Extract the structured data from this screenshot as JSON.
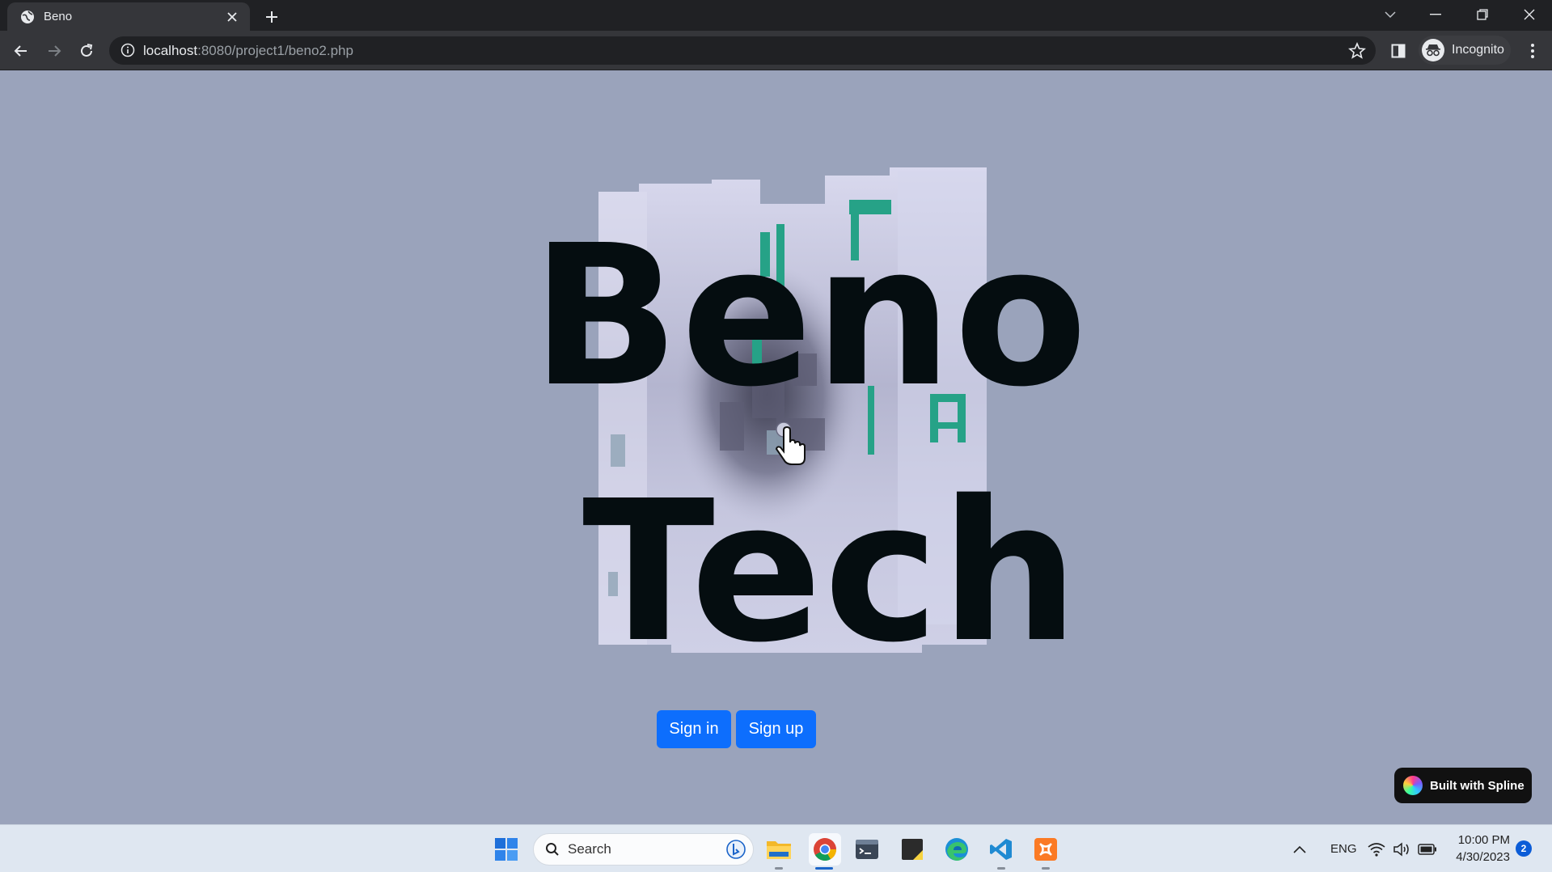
{
  "browser": {
    "tab_title": "Beno",
    "url_host": "localhost",
    "url_rest": ":8080/project1/beno2.php",
    "profile_label": "Incognito"
  },
  "page": {
    "hero_line1": "Beno",
    "hero_line2": "Tech",
    "signin_label": "Sign in",
    "signup_label": "Sign up",
    "spline_badge": "Built with Spline",
    "background_color": "#9aa3bb",
    "button_color": "#0d6efd",
    "accent_color": "#1fa58a"
  },
  "taskbar": {
    "search_placeholder": "Search",
    "language": "ENG",
    "time": "10:00 PM",
    "date": "4/30/2023",
    "notification_count": "2",
    "apps": [
      "start-icon",
      "file-explorer-icon",
      "chrome-icon",
      "terminal-icon",
      "sticky-notes-icon",
      "edge-icon",
      "vscode-icon",
      "xampp-icon"
    ]
  }
}
